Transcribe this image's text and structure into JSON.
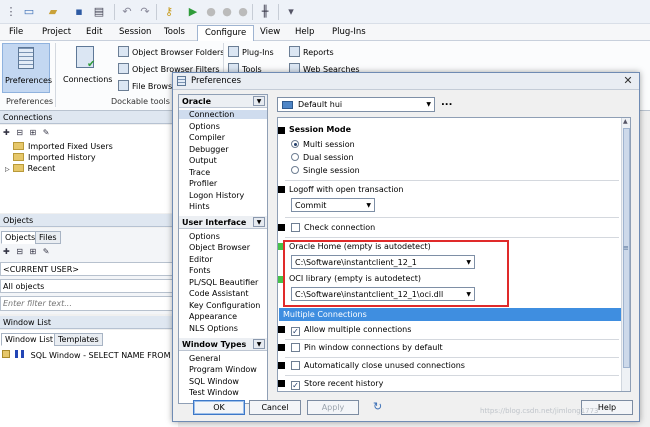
{
  "menu": [
    "File",
    "Project",
    "Edit",
    "Session",
    "Tools",
    "Configure",
    "View",
    "Help",
    "Plug-Ins"
  ],
  "ribbon": {
    "preferences": "Preferences",
    "preferences_group": "Preferences",
    "connections": "Connections",
    "object_browser_folders": "Object Browser Folders",
    "object_browser_filters": "Object Browser Filters",
    "file_browser": "File Browse",
    "dockable_tools_group": "Dockable tools",
    "plug_ins": "Plug-Ins",
    "tools": "Tools",
    "reports": "Reports",
    "web_searches": "Web Searches"
  },
  "connections_panel": {
    "title": "Connections",
    "items": [
      "Imported Fixed Users",
      "Imported History",
      "Recent"
    ]
  },
  "objects_panel": {
    "title": "Objects",
    "tabs": [
      "Objects",
      "Files"
    ],
    "current_user": "<CURRENT USER>",
    "all_objects": "All objects",
    "filter_placeholder": "Enter filter text..."
  },
  "window_list_panel": {
    "title": "Window List",
    "tabs": [
      "Window List",
      "Templates"
    ],
    "item": "SQL Window - SELECT NAME FROM V"
  },
  "dialog": {
    "title": "Preferences",
    "close": "✕",
    "scheme": "Default hui",
    "scheme_more": "...",
    "categories": {
      "oracle_title": "Oracle",
      "oracle_items": [
        "Connection",
        "Options",
        "Compiler",
        "Debugger",
        "Output",
        "Trace",
        "Profiler",
        "Logon History",
        "Hints"
      ],
      "ui_title": "User Interface",
      "ui_items": [
        "Options",
        "Object Browser",
        "Editor",
        "Fonts",
        "PL/SQL Beautifier",
        "Code Assistant",
        "Key Configuration",
        "Appearance",
        "NLS Options"
      ],
      "wt_title": "Window Types",
      "wt_items": [
        "General",
        "Program Window",
        "SQL Window",
        "Test Window"
      ]
    },
    "session_mode": {
      "title": "Session Mode",
      "options": [
        "Multi session",
        "Dual session",
        "Single session"
      ]
    },
    "logoff": {
      "label": "Logoff with open transaction",
      "value": "Commit"
    },
    "check_connection": "Check connection",
    "oracle_home": {
      "label": "Oracle Home (empty is autodetect)",
      "value": "C:\\Software\\instantclient_12_1"
    },
    "oci_library": {
      "label": "OCI library (empty is autodetect)",
      "value": "C:\\Software\\instantclient_12_1\\oci.dll"
    },
    "multiple_connections": {
      "title": "Multiple Connections",
      "options": [
        "Allow multiple connections",
        "Pin window connections by default",
        "Automatically close unused connections",
        "Store recent history"
      ]
    },
    "buttons": {
      "ok": "OK",
      "cancel": "Cancel",
      "apply": "Apply",
      "help": "Help"
    }
  },
  "watermark": "https://blog.csdn.net/jimlong1773"
}
